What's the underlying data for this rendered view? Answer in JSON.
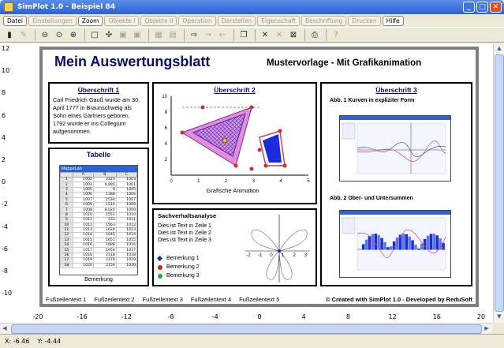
{
  "window": {
    "title": "SimPlot 1.0 - Beispiel 84",
    "min": "_",
    "max": "□",
    "close": "✕"
  },
  "menu": [
    "Datei",
    "Einstellungen",
    "Zoom",
    "Objekte I",
    "Objekte II",
    "Operation",
    "Darstellen",
    "Eigenschaft",
    "Beschriftung",
    "Drucken",
    "Hilfe"
  ],
  "axes": {
    "y_ticks": [
      "12",
      "10",
      "8",
      "6",
      "4",
      "2",
      "0",
      "-2",
      "-4",
      "-6",
      "-8",
      "-10"
    ],
    "x_ticks": [
      "-20",
      "-16",
      "-12",
      "-8",
      "-4",
      "0",
      "4",
      "8",
      "12",
      "16",
      "20"
    ]
  },
  "sheet": {
    "title": "Mein Auswertungsblatt",
    "subtitle": "Mustervorlage - Mit Grafikanimation",
    "h1": {
      "title": "Überschrift 1",
      "text": "Carl Friedrich Gauß wurde am 30. April 1777 in Braunschweig als Sohn eines Gärtners geboren. 1792 wurde er ins Collegium aufgenommen."
    },
    "table": {
      "title": "Tabelle",
      "caption": "Bemerkung",
      "tab_label": "MappeLab",
      "cols": [
        "A",
        "B",
        "C"
      ],
      "rows": [
        [
          "1",
          "1002",
          "2323",
          "1003"
        ],
        [
          "2",
          "1003",
          "4,995",
          "1001"
        ],
        [
          "3",
          "1005",
          "0",
          "1005"
        ],
        [
          "4",
          "1006",
          "1388",
          "1006"
        ],
        [
          "5",
          "1007",
          "1534",
          "1007"
        ],
        [
          "6",
          "1009",
          "1510",
          "1008"
        ],
        [
          "7",
          "1008",
          "8,024",
          "1009"
        ],
        [
          "8",
          "1010",
          "1551",
          "1010"
        ],
        [
          "9",
          "1011",
          "233",
          "1011"
        ],
        [
          "10",
          "1012",
          "1563",
          "1012"
        ],
        [
          "11",
          "1013",
          "1624",
          "1013"
        ],
        [
          "12",
          "1014",
          "1645",
          "1014"
        ],
        [
          "13",
          "1015",
          "1651",
          "1015"
        ],
        [
          "14",
          "1016",
          "1688",
          "1016"
        ],
        [
          "15",
          "1017",
          "1954",
          "1017"
        ],
        [
          "16",
          "1018",
          "2118",
          "1018"
        ],
        [
          "17",
          "1019",
          "2376",
          "1019"
        ],
        [
          "18",
          "1020",
          "2156",
          "1020"
        ]
      ]
    },
    "h2": {
      "title": "Überschrift 2",
      "xlabel": "Grafische Animation",
      "xticks": [
        "0",
        "1",
        "2",
        "3",
        "4",
        "5"
      ],
      "yticks": [
        "10",
        "8",
        "6",
        "4",
        "2"
      ]
    },
    "analysis": {
      "title": "Sachverhaltsanalyse",
      "lines": [
        "Dies ist Text in Zeile 1",
        "Dies ist Text in Zeile 2",
        "Dies ist Text in Zeile 3"
      ],
      "notes": [
        {
          "label": "Bemerkung 1",
          "color": "#1a2aa8"
        },
        {
          "label": "Bemerkung 2",
          "color": "#c42020"
        },
        {
          "label": "Bemerkung 3",
          "color": "#2aa82a"
        }
      ],
      "ticks": [
        "-2",
        "-1",
        "0",
        "1",
        "2",
        "3"
      ]
    },
    "h3": {
      "title": "Überschrift 3",
      "fig1": "Abb. 1  Kurven in expliziter Form",
      "fig2": "Abb. 2  Ober- und Untersummen"
    },
    "footer": {
      "items": [
        "Fußzeilentext 1",
        "Fußzeilentext 2",
        "Fußzeilentext 3",
        "Fußzeilentext 4",
        "Fußzeilentext 5"
      ],
      "credit": "© Created with SimPlot 1.0 - Developed by ReduSoft"
    }
  },
  "status": {
    "x": "X:  -6.46",
    "y": "Y:  -4.44"
  }
}
